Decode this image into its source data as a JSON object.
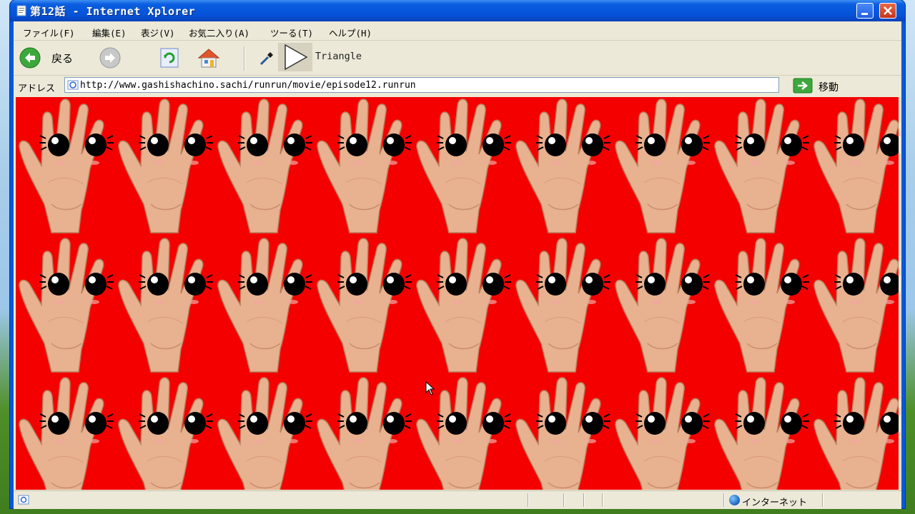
{
  "window": {
    "title": "第12話 - Internet Xplorer"
  },
  "menu": {
    "items": [
      "ファイル(F)",
      "編集(E)",
      "表ジ(V)",
      "お気二入り(A)",
      "ツーる(T)",
      "ヘルプ(H)"
    ]
  },
  "toolbar": {
    "back_label": "戻る",
    "triangle_label": "Triangle"
  },
  "address": {
    "label": "アドレス",
    "url": "http://www.gashishachino.sachi/runrun/movie/episode12.runrun",
    "go_label": "移動"
  },
  "status": {
    "zone": "インターネット"
  },
  "colors": {
    "content_background": "#f40000",
    "titlebar": "#0653d9",
    "chrome": "#ece9d8"
  },
  "content": {
    "pattern": "hand-with-eyes",
    "rows": 3,
    "columns": 9
  }
}
